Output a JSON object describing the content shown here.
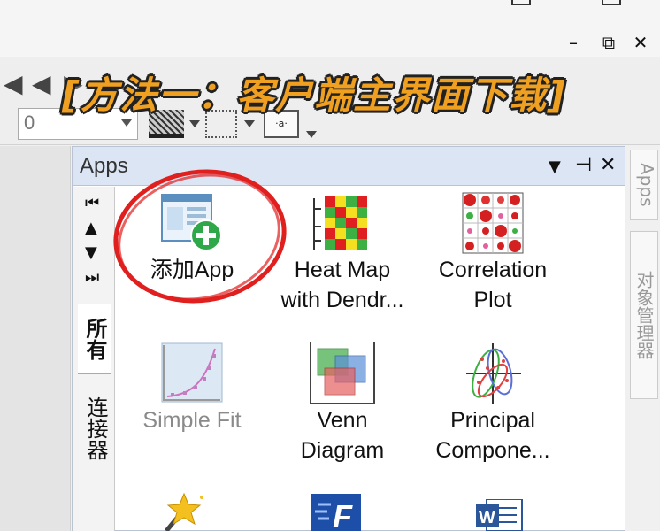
{
  "window": {
    "minimize_glyph": "–",
    "restore_glyph": "⧉",
    "close_glyph": "✕"
  },
  "toolbar": {
    "zero_field_value": "0",
    "textbox_glyph": "·a·"
  },
  "banner": {
    "text": "[方法一：客户端主界面下载]"
  },
  "apps_panel": {
    "title": "Apps",
    "pin_glyph": "⊣",
    "close_glyph": "✕",
    "dropdown_glyph": "▼",
    "nav": {
      "first": "⏮",
      "up": "▲",
      "down": "▼",
      "last": "⏭"
    },
    "vertical_tabs": [
      "所有",
      "连接器"
    ],
    "tiles": [
      {
        "label": "添加App",
        "dim": false
      },
      {
        "label": "Heat Map\nwith Dendr...",
        "line1": "Heat Map",
        "line2": "with Dendr...",
        "dim": false
      },
      {
        "label": "Correlation Plot",
        "line1": "Correlation",
        "line2": "Plot",
        "dim": false
      },
      {
        "label": "Simple Fit",
        "dim": true
      },
      {
        "label": "Venn Diagram",
        "line1": "Venn",
        "line2": "Diagram",
        "dim": false
      },
      {
        "label": "Principal Compone...",
        "line1": "Principal",
        "line2": "Compone...",
        "dim": false
      }
    ]
  },
  "right_strip": {
    "tabs": [
      "Apps",
      "对象管理器"
    ]
  },
  "icons": {
    "add_app": "add-app-icon",
    "heatmap": "heatmap-icon",
    "correlation": "correlation-plot-icon",
    "simple_fit": "simple-fit-icon",
    "venn": "venn-diagram-icon",
    "pca": "pca-icon",
    "wizard": "magic-wand-icon",
    "app_f": "app-f-icon",
    "word": "word-icon"
  },
  "colors": {
    "banner": "#f0a020",
    "annotation_circle": "#e0201e",
    "panel_header": "#dbe5f4"
  }
}
